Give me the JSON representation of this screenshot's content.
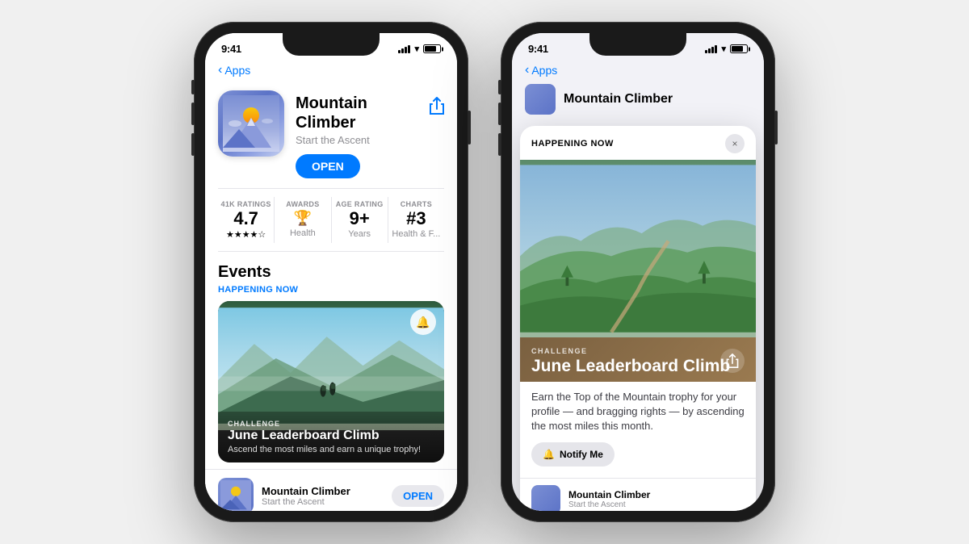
{
  "bg_color": "#f0f0f0",
  "phone1": {
    "time": "9:41",
    "back_label": "Apps",
    "app_name": "Mountain Climber",
    "app_subtitle": "Start the Ascent",
    "open_btn": "OPEN",
    "stats": {
      "ratings_label": "41K RATINGS",
      "rating_value": "4.7",
      "stars": "★★★★☆",
      "awards_label": "AWARDS",
      "editors_choice": "Editors' Choice",
      "awards_sub": "Health",
      "age_label": "AGE RATING",
      "age_value": "9+",
      "age_sub": "Years",
      "chart_label": "CHARTS",
      "chart_value": "#3",
      "chart_sub": "Health & F..."
    },
    "events_title": "Events",
    "happening_now": "HAPPENING NOW",
    "event": {
      "type": "CHALLENGE",
      "title": "June Leaderboard Climb",
      "desc": "Ascend the most miles and earn a unique trophy!"
    },
    "mini_app_name": "Mountain Climber",
    "mini_app_sub": "Start the Ascent",
    "mini_open_btn": "OPEN"
  },
  "phone2": {
    "time": "9:41",
    "back_label": "Apps",
    "app_name": "Mountain Climber",
    "popup_badge": "HAPPENING NOW",
    "close_icon": "×",
    "popup_challenge": "CHALLENGE",
    "popup_title": "June Leaderboard Climb",
    "popup_desc": "Earn the Top of the Mountain trophy for your profile — and bragging rights — by ascending the most miles this month.",
    "notify_btn": "Notify Me",
    "share_icon": "⬆"
  }
}
